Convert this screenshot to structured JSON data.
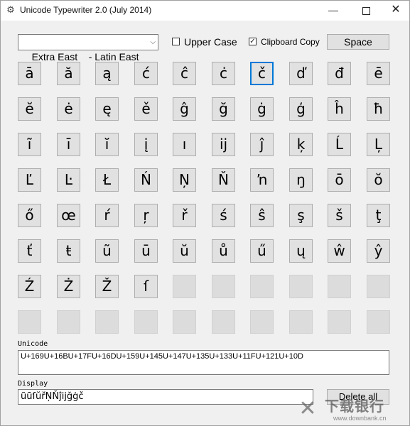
{
  "window": {
    "title": "Unicode Typewriter 2.0 (July 2014)",
    "icon": "gear-icon",
    "controls": {
      "minimize": "—",
      "close": "✕"
    }
  },
  "toolbar": {
    "charset_select": "Extra East    - Latin East",
    "upper_case_label": "Upper Case",
    "upper_case_checked": false,
    "clipboard_copy_label": "Clipboard Copy",
    "clipboard_copy_checked": true,
    "check_mark": "✓",
    "space_label": "Space"
  },
  "grid": {
    "selected_index": 6,
    "rows": [
      [
        "ā",
        "ă",
        "ą",
        "ć",
        "ĉ",
        "ċ",
        "č",
        "ď",
        "đ",
        "ē"
      ],
      [
        "ĕ",
        "ė",
        "ę",
        "ě",
        "ĝ",
        "ğ",
        "ġ",
        "ģ",
        "ĥ",
        "ħ"
      ],
      [
        "ĩ",
        "ī",
        "ĭ",
        "į",
        "ı",
        "ĳ",
        "ĵ",
        "ķ",
        "Ĺ",
        "Ļ"
      ],
      [
        "Ľ",
        "Ŀ",
        "Ł",
        "Ń",
        "Ņ",
        "Ň",
        "ŉ",
        "ŋ",
        "ō",
        "ŏ"
      ],
      [
        "ő",
        "œ",
        "ŕ",
        "ŗ",
        "ř",
        "ś",
        "ŝ",
        "ş",
        "š",
        "ţ"
      ],
      [
        "ť",
        "ŧ",
        "ũ",
        "ū",
        "ŭ",
        "ů",
        "ű",
        "ų",
        "ŵ",
        "ŷ"
      ],
      [
        "Ź",
        "Ż",
        "Ž",
        "ſ",
        "",
        "",
        "",
        "",
        "",
        ""
      ],
      [
        "",
        "",
        "",
        "",
        "",
        "",
        "",
        "",
        "",
        ""
      ]
    ]
  },
  "unicode": {
    "label": "Unicode",
    "value": "U+169U+16BU+17FU+16DU+159U+145U+147U+135U+133U+11FU+121U+10D"
  },
  "display": {
    "label": "Display",
    "value": "ũūſŭřŅŇĵĳğġč"
  },
  "delete_label": "Delete all",
  "watermark": {
    "logo": "downbank-logo-icon",
    "cn_text": "下载银行",
    "url": "www.downbank.cn"
  }
}
